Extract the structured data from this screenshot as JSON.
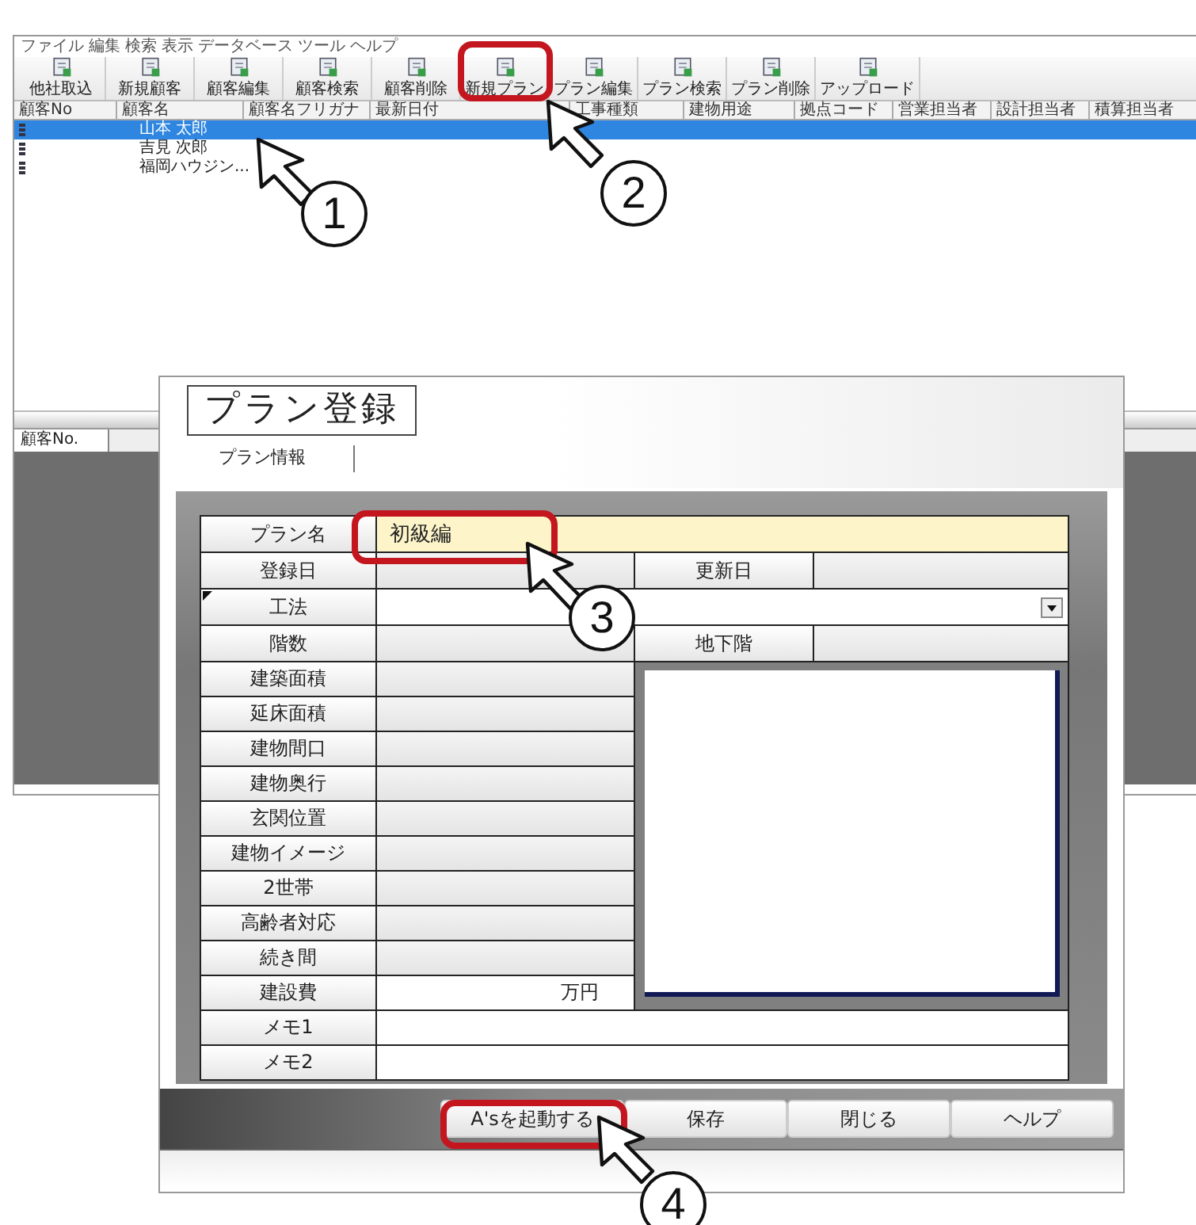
{
  "main": {
    "menu": [
      "ファイル",
      "編集",
      "検索",
      "表示",
      "データベース",
      "ツール",
      "ヘルプ"
    ],
    "toolbar": [
      {
        "label": "他社取込"
      },
      {
        "label": "新規顧客"
      },
      {
        "label": "顧客編集"
      },
      {
        "label": "顧客検索"
      },
      {
        "label": "顧客削除"
      },
      {
        "label": "新規プラン"
      },
      {
        "label": "プラン編集"
      },
      {
        "label": "プラン検索"
      },
      {
        "label": "プラン削除"
      },
      {
        "label": "アップロード"
      }
    ],
    "columns": [
      "顧客No",
      "顧客名",
      "顧客名フリガナ",
      "最新日付",
      "工事種類",
      "建物用途",
      "拠点コード",
      "営業担当者",
      "設計担当者",
      "積算担当者"
    ],
    "rows": [
      {
        "name": "山本 太郎",
        "selected": true
      },
      {
        "name": "吉見 次郎",
        "selected": false
      },
      {
        "name": "福岡ハウジン...",
        "selected": false
      }
    ],
    "bottom_tab": "顧客No."
  },
  "dialog": {
    "title": "プラン登録",
    "tab": "プラン情報",
    "fields": [
      {
        "kind": "highlight",
        "label": "プラン名",
        "value": "初級編"
      },
      {
        "kind": "pair",
        "label": "登録日",
        "label2": "更新日"
      },
      {
        "kind": "dropdown",
        "label": "工法"
      },
      {
        "kind": "pair",
        "label": "階数",
        "label2": "地下階"
      },
      {
        "kind": "short",
        "label": "建築面積"
      },
      {
        "kind": "short",
        "label": "延床面積"
      },
      {
        "kind": "short",
        "label": "建物間口"
      },
      {
        "kind": "short",
        "label": "建物奥行"
      },
      {
        "kind": "short",
        "label": "玄関位置"
      },
      {
        "kind": "short",
        "label": "建物イメージ"
      },
      {
        "kind": "short",
        "label": "2世帯"
      },
      {
        "kind": "short",
        "label": "高齢者対応"
      },
      {
        "kind": "short",
        "label": "続き間"
      },
      {
        "kind": "cost",
        "label": "建設費",
        "unit": "万円"
      },
      {
        "kind": "wide",
        "label": "メモ1"
      },
      {
        "kind": "wide",
        "label": "メモ2"
      }
    ],
    "buttons": [
      "A'sを起動する",
      "保存",
      "閉じる",
      "ヘルプ"
    ]
  },
  "callouts": [
    {
      "number": "1",
      "highlighted": false
    },
    {
      "number": "2",
      "highlighted": true
    },
    {
      "number": "3",
      "highlighted": true
    },
    {
      "number": "4",
      "highlighted": true
    }
  ]
}
